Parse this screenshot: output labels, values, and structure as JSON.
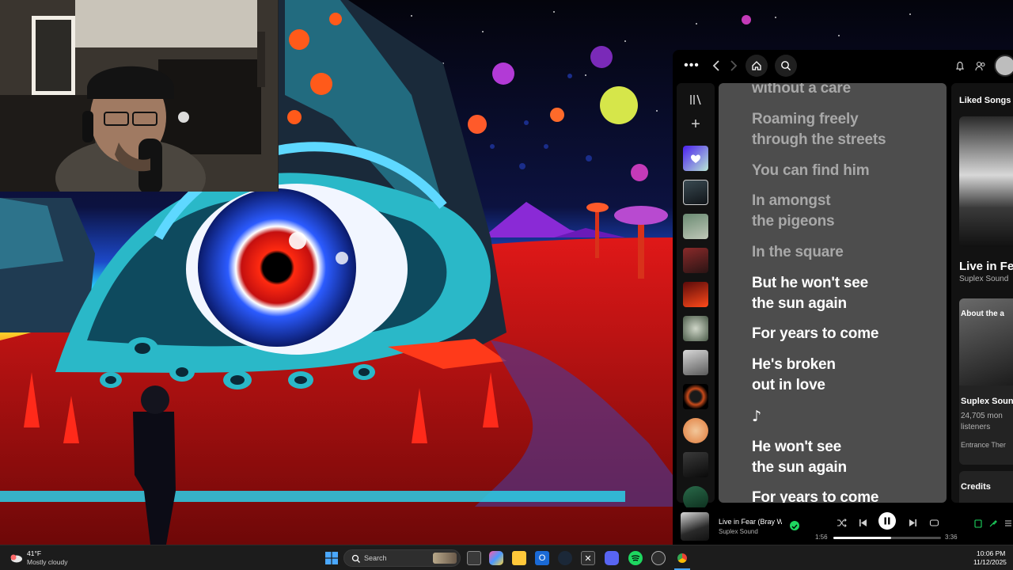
{
  "spotify": {
    "right_panel": {
      "header": "Liked Songs",
      "track_title": "Live in Fea",
      "track_artist": "Suplex Sound",
      "about_heading": "About the a",
      "artist_name": "Suplex Soun",
      "listeners_count": "24,705 mon",
      "listeners_label": "listeners",
      "artist_blurb": "Entrance Ther",
      "credits_heading": "Credits"
    },
    "lyrics": [
      {
        "text": "without a care",
        "state": "past"
      },
      {
        "text": "Roaming freely",
        "state": "past"
      },
      {
        "text": "through the streets",
        "state": "past"
      },
      {
        "text": "You can find him",
        "state": "past"
      },
      {
        "text": "In amongst",
        "state": "past"
      },
      {
        "text": "the pigeons",
        "state": "past"
      },
      {
        "text": "In the square",
        "state": "past"
      },
      {
        "text": "But he won't see",
        "state": "active"
      },
      {
        "text": "the sun again",
        "state": "active"
      },
      {
        "text": "For years to come",
        "state": "active"
      },
      {
        "text": "He's broken",
        "state": "active"
      },
      {
        "text": "out in love",
        "state": "active"
      },
      {
        "text": "♪",
        "state": "active"
      },
      {
        "text": "He won't see",
        "state": "active"
      },
      {
        "text": "the sun again",
        "state": "active"
      },
      {
        "text": "For years to come",
        "state": "active"
      }
    ],
    "player": {
      "track_title": "Live in Fear (Bray W",
      "track_artist": "Suplex Sound",
      "elapsed": "1:56",
      "duration": "3:36",
      "progress": 0.537
    },
    "colors": {
      "accent": "#1ed760",
      "lyrics_bg": "#4d4d4d",
      "bg": "#000000",
      "liked_songs": "#7e59ff"
    }
  },
  "taskbar": {
    "weather_temp": "41°F",
    "weather_desc": "Mostly cloudy",
    "search_placeholder": "Search",
    "time": "10:06 PM",
    "date": "11/12/2025"
  }
}
